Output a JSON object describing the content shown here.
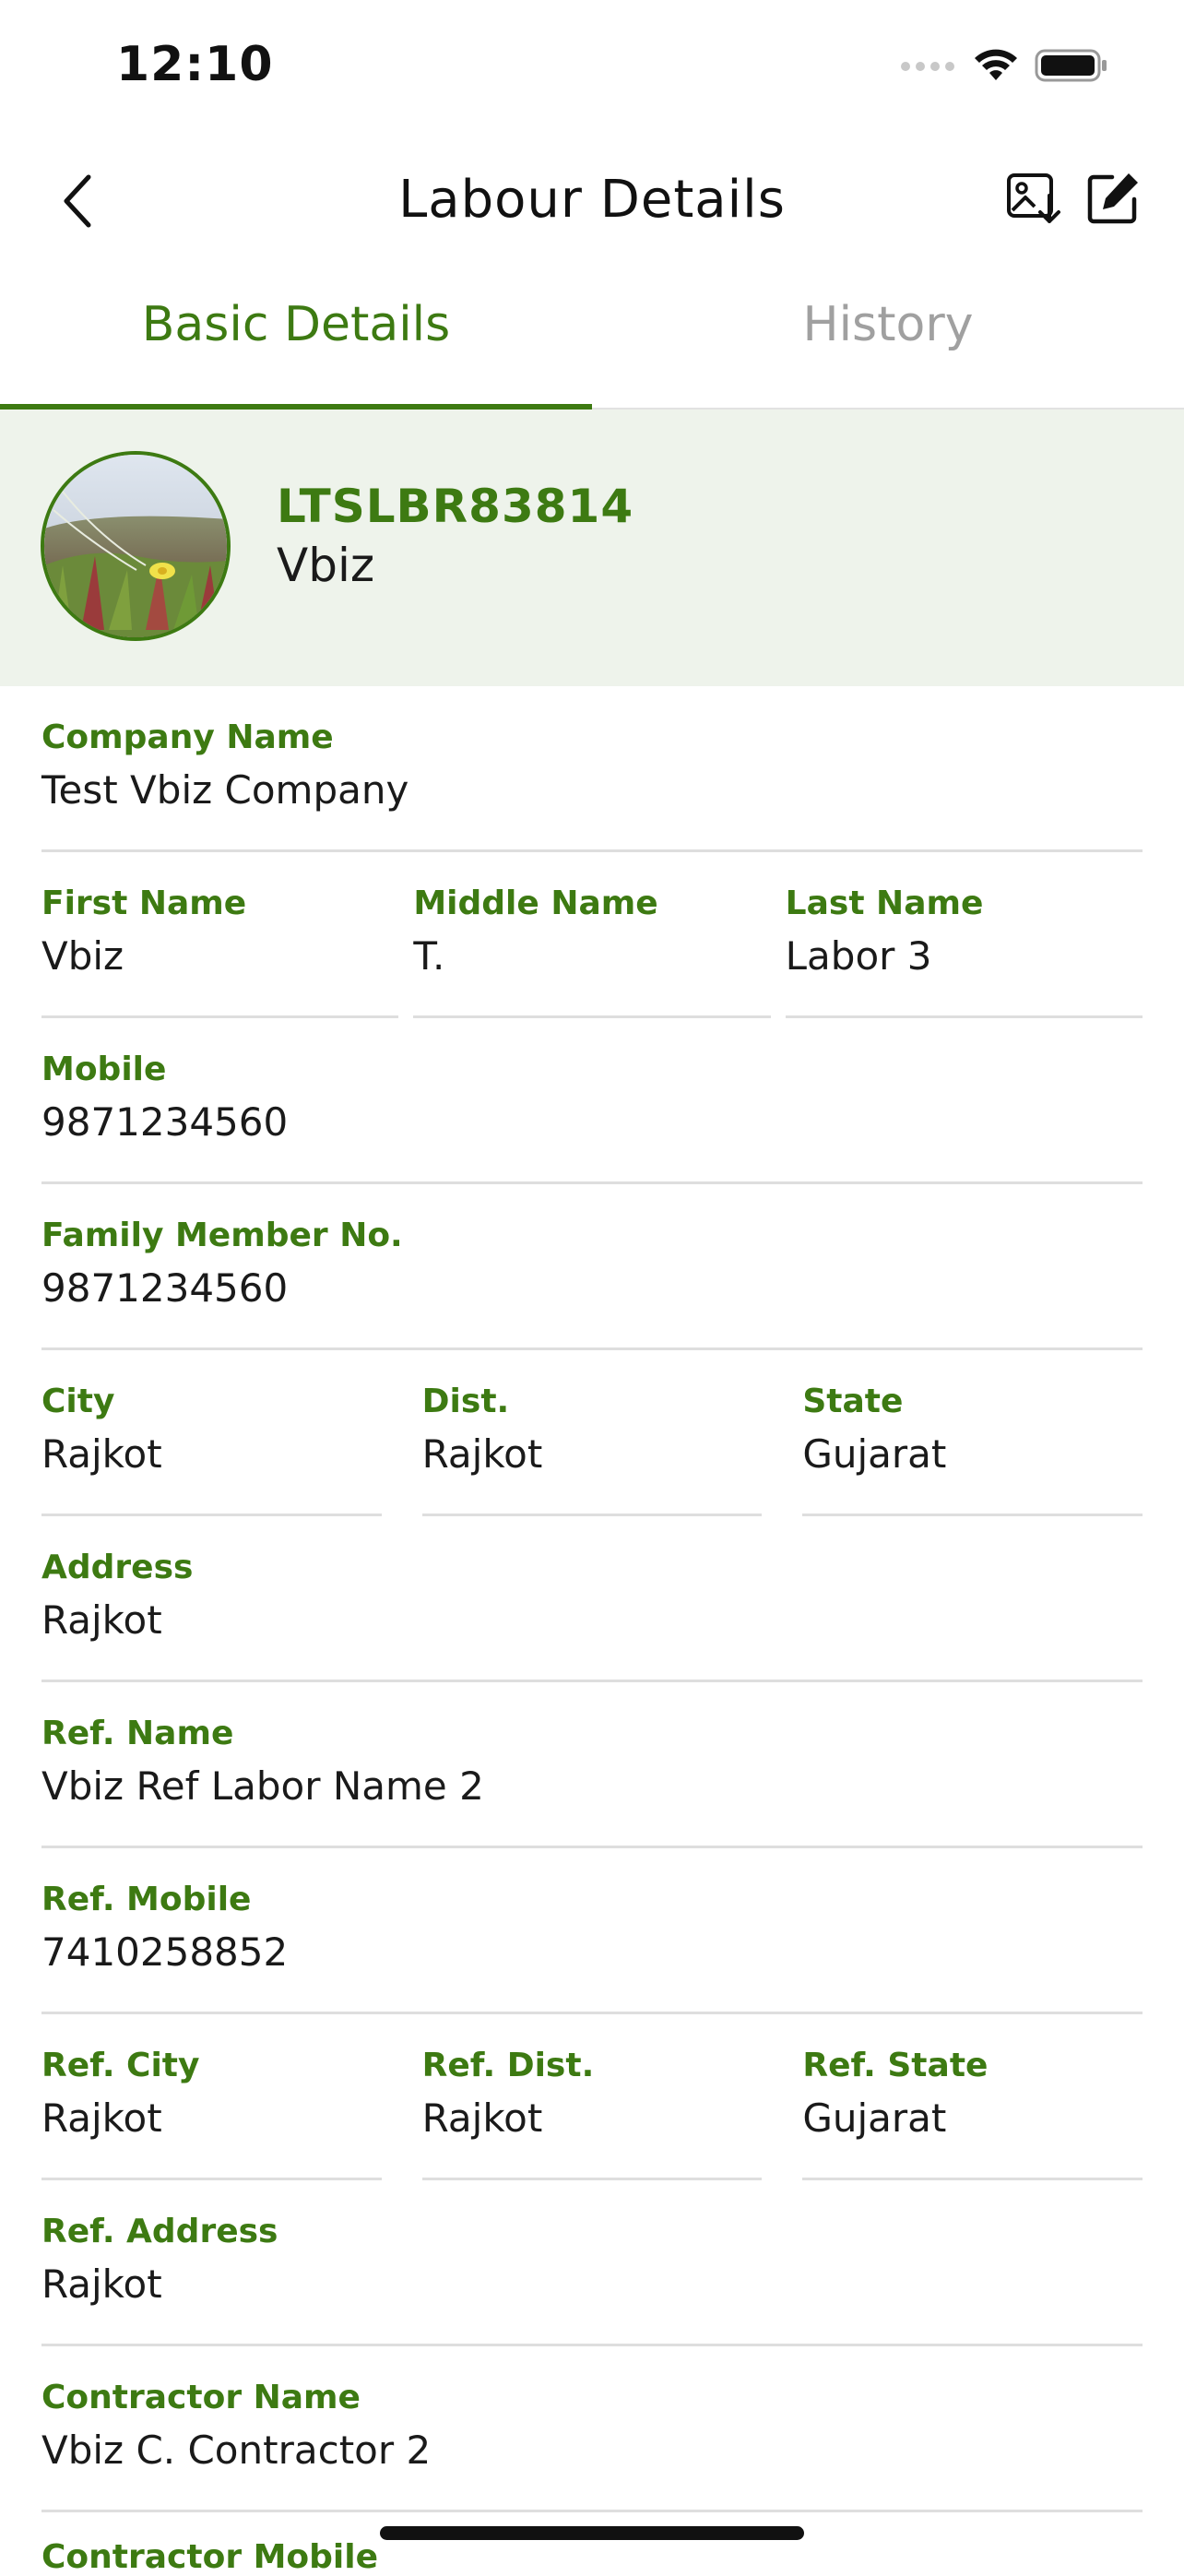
{
  "status_bar": {
    "time": "12:10",
    "icons": [
      "signal-dots-icon",
      "wifi-icon",
      "battery-icon"
    ]
  },
  "header": {
    "title": "Labour Details",
    "back_icon": "chevron-left-icon",
    "actions": [
      "image-download-icon",
      "edit-icon"
    ]
  },
  "tabs": [
    {
      "label": "Basic Details",
      "active": true
    },
    {
      "label": "History",
      "active": false
    }
  ],
  "profile": {
    "id": "LTSLBR83814",
    "name": "Vbiz"
  },
  "fields": {
    "company_name": {
      "label": "Company Name",
      "value": "Test Vbiz Company"
    },
    "first_name": {
      "label": "First Name",
      "value": "Vbiz"
    },
    "middle_name": {
      "label": "Middle Name",
      "value": "T."
    },
    "last_name": {
      "label": "Last Name",
      "value": "Labor 3"
    },
    "mobile": {
      "label": "Mobile",
      "value": "9871234560"
    },
    "family_member_no": {
      "label": "Family Member No.",
      "value": "9871234560"
    },
    "city": {
      "label": "City",
      "value": "Rajkot"
    },
    "dist": {
      "label": "Dist.",
      "value": "Rajkot"
    },
    "state": {
      "label": "State",
      "value": "Gujarat"
    },
    "address": {
      "label": "Address",
      "value": "Rajkot"
    },
    "ref_name": {
      "label": "Ref. Name",
      "value": "Vbiz Ref Labor Name 2"
    },
    "ref_mobile": {
      "label": "Ref. Mobile",
      "value": "7410258852"
    },
    "ref_city": {
      "label": "Ref. City",
      "value": "Rajkot"
    },
    "ref_dist": {
      "label": "Ref. Dist.",
      "value": "Rajkot"
    },
    "ref_state": {
      "label": "Ref. State",
      "value": "Gujarat"
    },
    "ref_address": {
      "label": "Ref. Address",
      "value": "Rajkot"
    },
    "contractor_name": {
      "label": "Contractor Name",
      "value": "Vbiz C. Contractor 2"
    },
    "contractor_mobile": {
      "label": "Contractor Mobile"
    }
  },
  "colors": {
    "accent": "#3d7a12",
    "profile_bg": "#eef3eb",
    "divider": "#dedede",
    "inactive_tab": "#a0a0a0"
  }
}
